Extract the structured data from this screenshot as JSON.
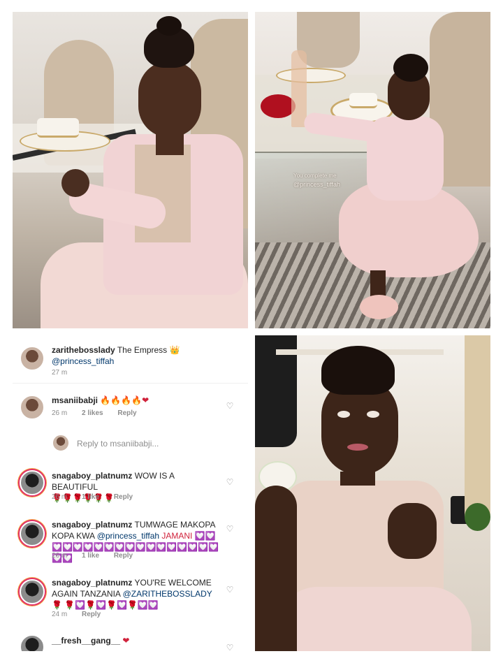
{
  "photos": {
    "top_left": "photo",
    "top_right": "photo",
    "bottom_right": "photo"
  },
  "watermark": {
    "line1": "You complete me",
    "line2": "@princess_tiffah"
  },
  "comments": [
    {
      "username": "zarithebosslady",
      "text": "The Empress 👑",
      "mention": "@princess_tiffah",
      "time": "27 m"
    },
    {
      "username": "msaniibabji",
      "text": "🔥🔥🔥🔥❤",
      "time": "26 m",
      "likes": "2 likes",
      "reply": "Reply"
    },
    {
      "reply_prompt": "Reply to msaniibabji..."
    },
    {
      "username": "snagaboy_platnumz",
      "text": "WOW IS A BEAUTIFUL",
      "text2": "🌹🌹🌹🌹🌹🌹",
      "time": "26 m",
      "likes": "1 like",
      "reply": "Reply"
    },
    {
      "username": "snagaboy_platnumz",
      "text": "TUMWAGE MAKOPA KOPA KWA",
      "mention": "@princess_tiffah",
      "text_after": "JAMANI 💟💟",
      "text2": "💟💟💟💟💟💟💟💟💟💟💟💟💟💟💟💟💟💟",
      "time": "26 m",
      "likes": "1 like",
      "reply": "Reply"
    },
    {
      "username": "snagaboy_platnumz",
      "text": "YOU'RE WELCOME AGAIN TANZANIA",
      "mention": "@ZARITHEBOSSLADY",
      "text_after": "🌹",
      "text2": "🌹💟🌹💟🌹💟🌹💟💟",
      "time": "24 m",
      "reply": "Reply"
    },
    {
      "username": "__fresh__gang__",
      "text": "❤"
    }
  ],
  "icons": {
    "like": "heart-outline-icon"
  }
}
